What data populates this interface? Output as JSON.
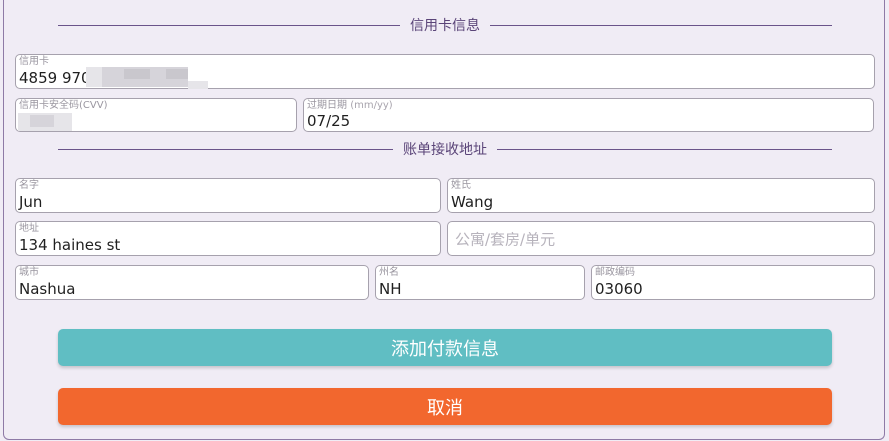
{
  "sections": {
    "credit_card_title": "信用卡信息",
    "billing_title": "账单接收地址"
  },
  "fields": {
    "card_number": {
      "label": "信用卡",
      "value": "4859 970"
    },
    "cvv": {
      "label": "信用卡安全码(CVV)"
    },
    "expiry": {
      "label": "过期日期",
      "hint": "(mm/yy)",
      "value": "07/25"
    },
    "first_name": {
      "label": "名字",
      "value": "Jun"
    },
    "last_name": {
      "label": "姓氏",
      "value": "Wang"
    },
    "address": {
      "label": "地址",
      "value": "134 haines st"
    },
    "apt": {
      "placeholder": "公寓/套房/单元"
    },
    "city": {
      "label": "城市",
      "value": "Nashua"
    },
    "state": {
      "label": "州名",
      "value": "NH"
    },
    "zip": {
      "label": "邮政编码",
      "value": "03060"
    }
  },
  "buttons": {
    "add_payment": "添加付款信息",
    "cancel": "取消"
  },
  "colors": {
    "add_button": "#60bec3",
    "cancel_button": "#f2672e",
    "section_title": "#5a4478"
  }
}
